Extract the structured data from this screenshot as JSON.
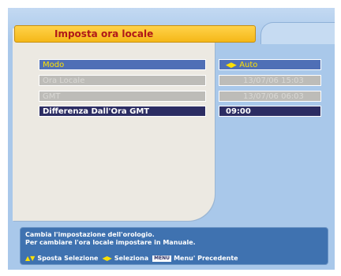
{
  "title": "Imposta ora locale",
  "menu": {
    "rows": [
      {
        "label": "Modo",
        "value": "Auto",
        "state": "highlighted"
      },
      {
        "label": "Ora Locale",
        "value": "13/07/06 15:03",
        "state": "disabled"
      },
      {
        "label": "GMT",
        "value": "13/07/06 06:03",
        "state": "disabled"
      },
      {
        "label": "Differenza Dall'Ora GMT",
        "value": "09:00",
        "state": "selected"
      }
    ]
  },
  "help": {
    "line1": "Cambia l'impostazione dell'orologio.",
    "line2": " Per cambiare l'ora locale impostare in Manuale.",
    "legend": {
      "move_label": "Sposta Selezione",
      "select_label": "Seleziona",
      "menu_key": "MENU",
      "back_label": "Menu' Precedente"
    }
  },
  "icons": {
    "mode_arrows": "left-right-arrow-icon",
    "updown": "up-down-arrow-icon",
    "leftright": "left-right-arrow-icon"
  },
  "colors": {
    "highlight": "#4f6fb6",
    "selected": "#2c2d63",
    "title_bar": "#f5b818",
    "title_text": "#b01818",
    "backdrop": "#a9c8ea"
  }
}
